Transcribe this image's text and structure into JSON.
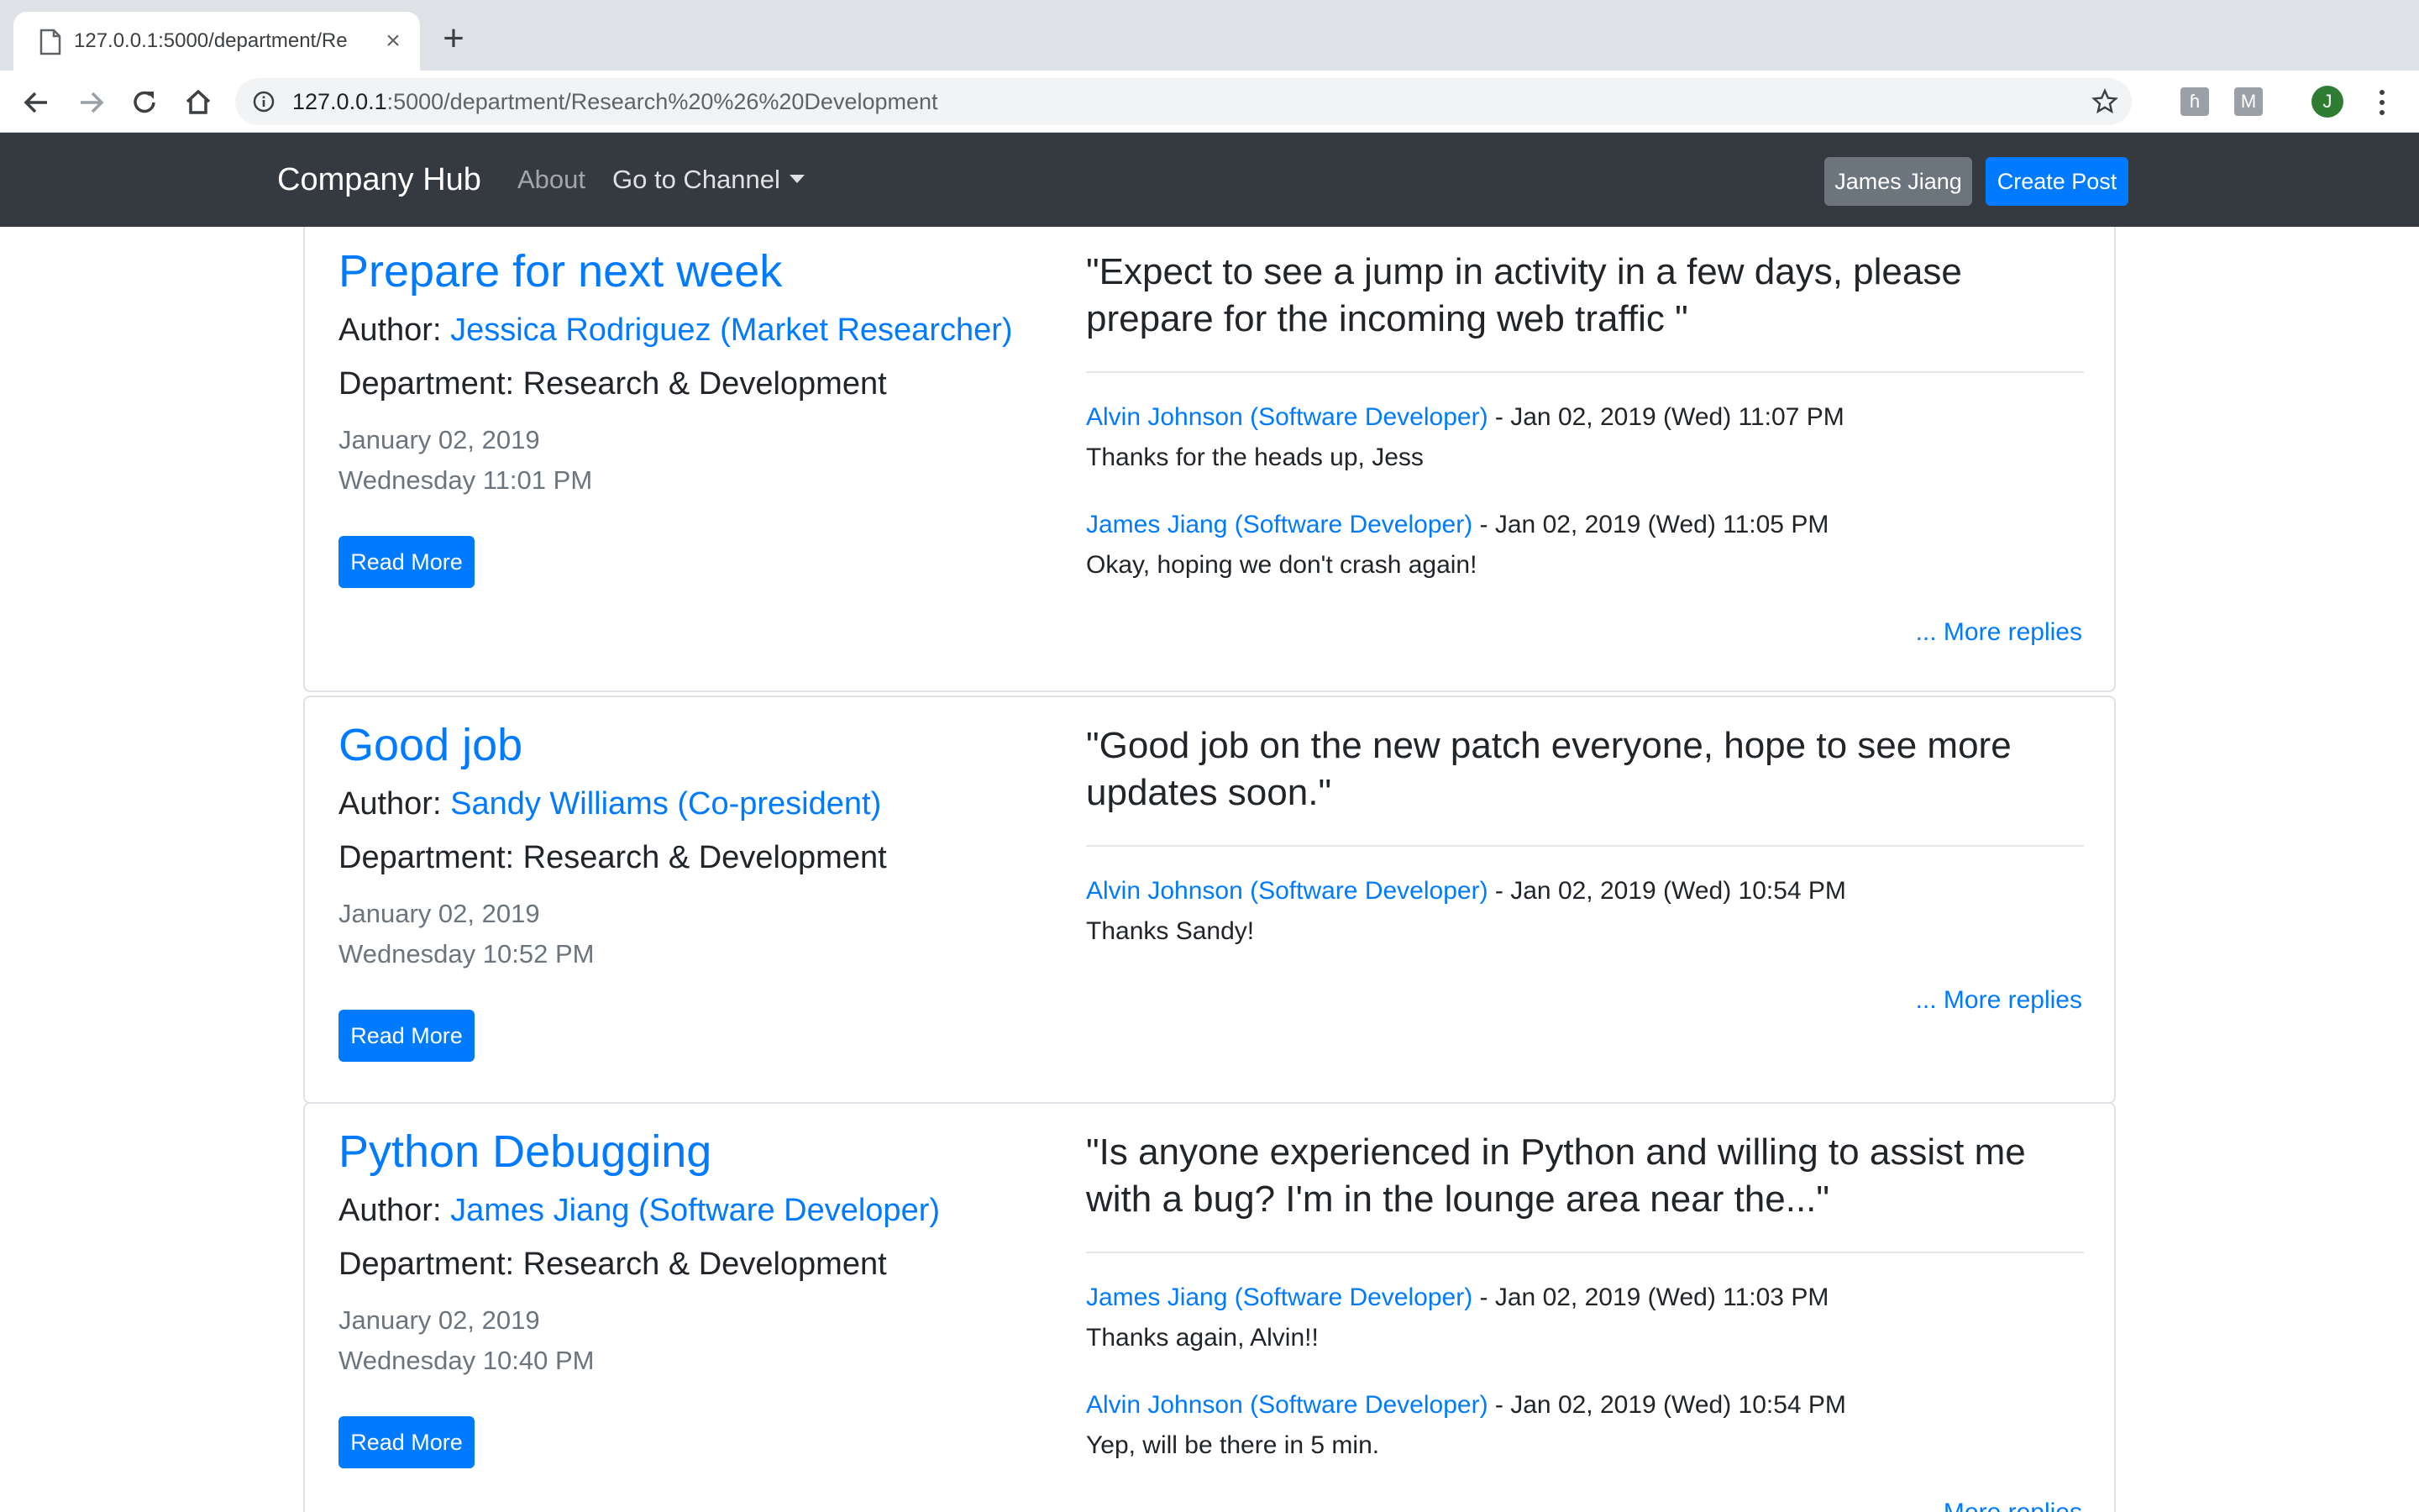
{
  "browser": {
    "tab_title": "127.0.0.1:5000/department/Re",
    "tab_close": "×",
    "new_tab": "+",
    "url_host": "127.0.0.1",
    "url_rest": ":5000/department/Research%20%26%20Development",
    "profile_initial": "J"
  },
  "navbar": {
    "brand": "Company Hub",
    "about": "About",
    "channel": "Go to Channel",
    "user_button": "James Jiang",
    "create_button": "Create Post"
  },
  "posts": [
    {
      "title": "Prepare for next week",
      "author_label": "Author:",
      "author": "Jessica Rodriguez (Market Researcher)",
      "department": "Department: Research & Development",
      "date": "January 02, 2019",
      "time": "Wednesday 11:01 PM",
      "read_more": "Read More",
      "quote": "\"Expect to see a jump in activity in a few days, please prepare for the incoming web traffic \"",
      "replies": [
        {
          "author": "Alvin Johnson (Software Developer)",
          "meta": " - Jan 02, 2019 (Wed) 11:07 PM",
          "text": "Thanks for the heads up, Jess"
        },
        {
          "author": "James Jiang (Software Developer)",
          "meta": " - Jan 02, 2019 (Wed) 11:05 PM",
          "text": "Okay, hoping we don't crash again!"
        }
      ],
      "more_replies": "... More replies"
    },
    {
      "title": "Good job",
      "author_label": "Author:",
      "author": "Sandy Williams (Co-president)",
      "department": "Department: Research & Development",
      "date": "January 02, 2019",
      "time": "Wednesday 10:52 PM",
      "read_more": "Read More",
      "quote": "\"Good job on the new patch everyone, hope to see more updates soon.\"",
      "replies": [
        {
          "author": "Alvin Johnson (Software Developer)",
          "meta": " - Jan 02, 2019 (Wed) 10:54 PM",
          "text": "Thanks Sandy!"
        }
      ],
      "more_replies": "... More replies"
    },
    {
      "title": "Python Debugging",
      "author_label": "Author:",
      "author": "James Jiang (Software Developer)",
      "department": "Department: Research & Development",
      "date": "January 02, 2019",
      "time": "Wednesday 10:40 PM",
      "read_more": "Read More",
      "quote": "\"Is anyone experienced in Python and willing to assist me with a bug? I'm in the lounge area near the...\"",
      "replies": [
        {
          "author": "James Jiang (Software Developer)",
          "meta": " - Jan 02, 2019 (Wed) 11:03 PM",
          "text": "Thanks again, Alvin!!"
        },
        {
          "author": "Alvin Johnson (Software Developer)",
          "meta": " - Jan 02, 2019 (Wed) 10:54 PM",
          "text": "Yep, will be there in 5 min."
        }
      ],
      "more_replies": "... More replies"
    }
  ],
  "colors": {
    "navbar": "#343a40",
    "primary": "#007bff",
    "secondary": "#6c757d"
  }
}
